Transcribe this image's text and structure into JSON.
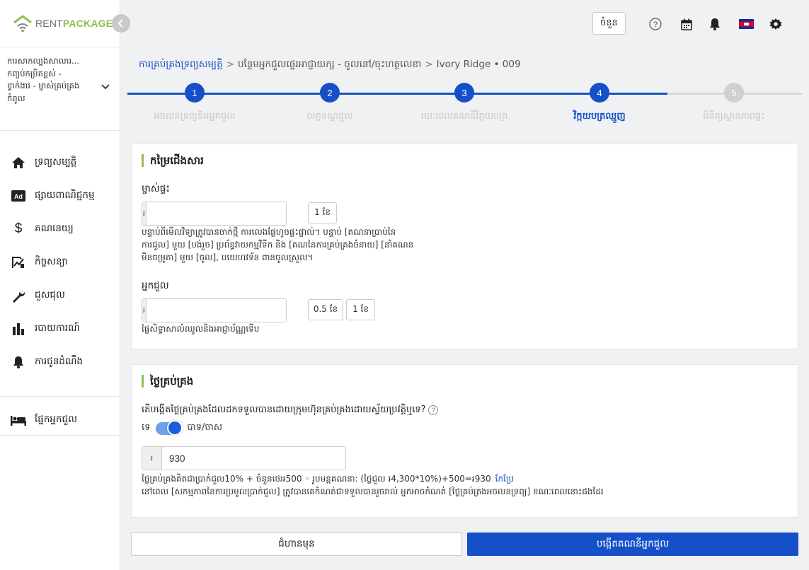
{
  "colors": {
    "primary": "#1650c9",
    "accent_green": "#8cc152",
    "step_inactive": "#d0d0d0"
  },
  "logo": {
    "rent": "RENT",
    "package": "PACKAGE"
  },
  "sidebar": {
    "property_select": "ការសាកល្បងសាលារ... កញ្ចប់កម្រិតខ្ពស់ - ខ្ទាក់ងារ - ម្ចាស់គ្រប់គ្រង កំពូល",
    "items": [
      {
        "label": "ទ្រព្យសម្បត្តិ",
        "icon": "home-icon"
      },
      {
        "label": "ផ្សាយពាណិជ្ជកម្ម",
        "icon": "ad-icon"
      },
      {
        "label": "គណនេយ្យ",
        "icon": "dollar-icon"
      },
      {
        "label": "កិច្ចសន្យា",
        "icon": "contract-icon"
      },
      {
        "label": "ជួសជុល",
        "icon": "wrench-icon"
      },
      {
        "label": "របាយការណ៍",
        "icon": "bar-chart-icon"
      },
      {
        "label": "ការជូនដំណឹង",
        "icon": "bell-icon"
      }
    ],
    "bottom_item": {
      "label": "ផ្នែកអ្នកជួល",
      "icon": "bed-icon"
    }
  },
  "topbar": {
    "quantity_button": "ចំនួន",
    "icons": [
      "help-icon",
      "calendar-icon",
      "bell-icon",
      "cambodia-flag-icon",
      "gear-icon"
    ]
  },
  "breadcrumb": {
    "items": [
      "ការគ្រប់គ្រងទ្រព្យសម្បត្តិ",
      "បន្ថែមអ្នកជួលផ្ទេរអាជ្ញាយក្ស - ចូលនៅ/ចុះហត្ថលេខា",
      "Ivory Ridge • 009"
    ],
    "separator": ">"
  },
  "stepper": {
    "current": 4,
    "steps": [
      {
        "num": "1",
        "label": "អចលនទ្រព្យនិងអ្នកជួល"
      },
      {
        "num": "2",
        "label": "លក្ខខណ្ឌជួល"
      },
      {
        "num": "3",
        "label": "រយៈពេលគណនីវិក្កយបត្រ"
      },
      {
        "num": "4",
        "label": "វិក្កយបត្រឈ្មួញ"
      },
      {
        "num": "5",
        "label": "ពិនិត្យស្ថានភាពផ្ទះ"
      }
    ]
  },
  "commission": {
    "title": "កម្រៃជើងសារ",
    "owner": {
      "label": "ម្ចាស់ផ្ទះ",
      "currency": "៛",
      "value": "",
      "chips": [
        "1 ខែ"
      ],
      "help": [
        "បន្ទាប់ពីមើលវិទ្យាត្រូវបានចាក់ថ្មី ការលេងផ្លែហូចផ្ទះផ្ទាល់។ បន្ទាប់ [គណនាប្រាប់នៃ",
        "ការជួល] មួយ [បង់រួច] ប្រព័ន្ធវាយកម្មវិទីក និង [គណនៃការគ្រប់គ្រងចំនាយ] [នាំគណន",
        "មិនចម្រូតា] មួយ [ចូល], បយេហវទ័ន ពានចូលស្រួល។"
      ]
    },
    "tenant": {
      "label": "អ្នកជួល",
      "currency": "៛",
      "value": "",
      "chips": [
        "0.5 ខែ",
        "1 ខែ"
      ],
      "help": "ផ្លៃសិទ្ធាសាលំឈូលនិងអាជ្ញាប័ណ្ណទើប"
    }
  },
  "management": {
    "title": "ថ្លៃគ្រប់គ្រង",
    "question": "តើបង្កើតថ្លៃគ្រប់គ្រងដែលដកទទួលបានដោយក្រុមហ៊ុនគ្រប់គ្រងដោយស្វ័យប្រវត្តិឬទេ?",
    "toggle_no": "ទេ",
    "toggle_yes": "បាទ/ចាស",
    "toggle_on": true,
    "currency": "៛",
    "value": "930",
    "formula": "ថ្លៃគ្រប់គ្រងគិតជាប្រាក់ជួល10% + ចំនួនថេរ៛500 ◦ រូបមន្តគណនា: (ថ្លៃជួល ៛4,300*10%)+500=៛930",
    "edit_link": "កែប្រែ",
    "note": "នៅពេល [សកម្មភាពនៃការប្រមូលប្រាក់ជួល] ត្រូវបានគេកំណត់ជាទទួលបានរួចរាល់ អ្នកអាចកំណត់ [ថ្លៃគ្រប់គ្រងអចលនទ្រព្យ] ខណៈពេលនោះផងដែរ"
  },
  "footer": {
    "prev_button": "ជំហានមុន",
    "next_button": "បង្កើតគណនីអ្នកជួល"
  }
}
